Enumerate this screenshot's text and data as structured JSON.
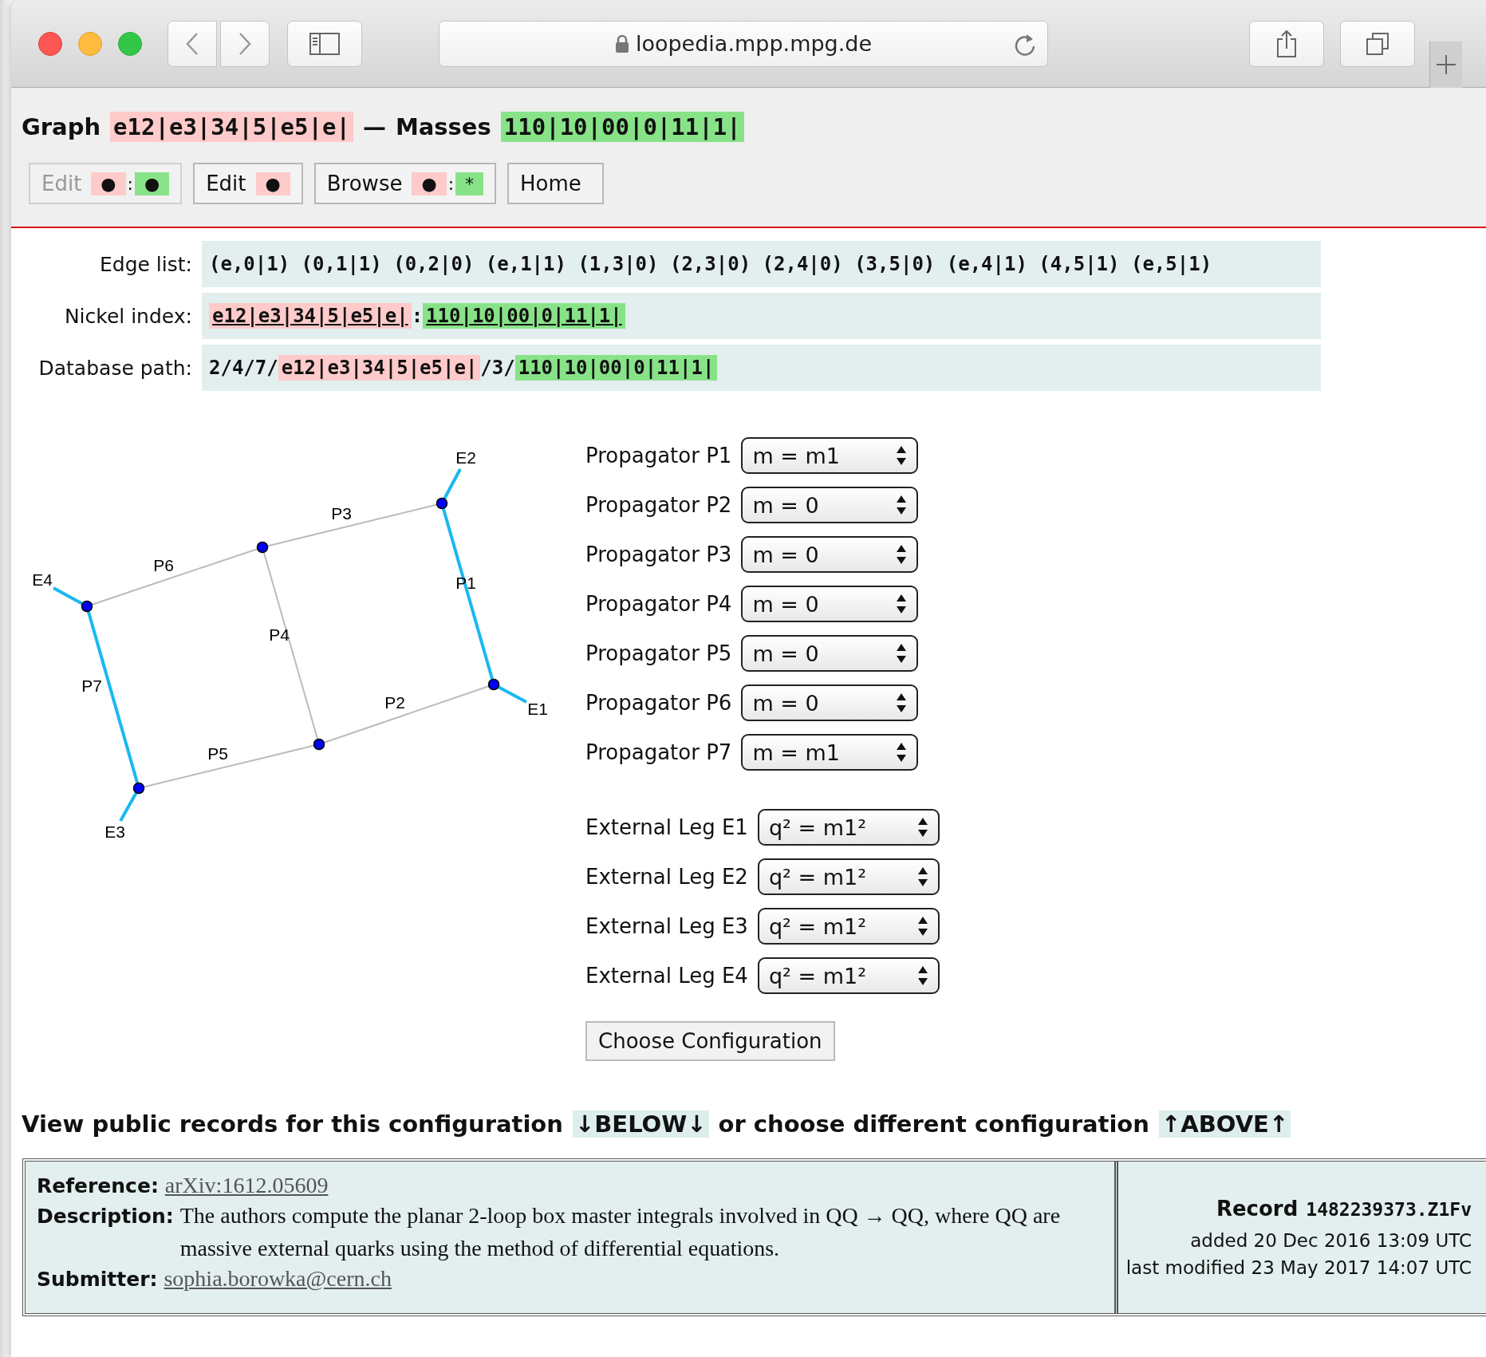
{
  "browser": {
    "url": "loopedia.mpp.mpg.de"
  },
  "header": {
    "graph_label": "Graph",
    "graph": "e12|e3|34|5|e5|e|",
    "separator": "—",
    "masses_label": "Masses",
    "masses": "110|10|00|0|11|1|"
  },
  "nav_buttons": [
    {
      "label": "Edit",
      "disabled": true,
      "parts": [
        {
          "text": "●",
          "kind": "graph"
        },
        {
          "text": ":",
          "kind": "sep"
        },
        {
          "text": "●",
          "kind": "masses"
        }
      ]
    },
    {
      "label": "Edit",
      "disabled": false,
      "parts": [
        {
          "text": "●",
          "kind": "graph"
        }
      ]
    },
    {
      "label": "Browse",
      "disabled": false,
      "parts": [
        {
          "text": "●",
          "kind": "graph"
        },
        {
          "text": ":",
          "kind": "sep"
        },
        {
          "text": "*",
          "kind": "masses"
        }
      ]
    },
    {
      "label": "Home",
      "disabled": false
    }
  ],
  "info": [
    {
      "label": "Edge list:",
      "kind": "text",
      "parts": [
        {
          "text": "(e,0|1) (0,1|1) (0,2|0) (e,1|1) (1,3|0) (2,3|0) (2,4|0) (3,5|0) (e,4|1) (4,5|1) (e,5|1)",
          "kind": "plain"
        }
      ]
    },
    {
      "label": "Nickel index:",
      "kind": "links",
      "parts": [
        {
          "text": "e12|e3|34|5|e5|e|",
          "kind": "graph"
        },
        {
          "text": ":",
          "kind": "plain"
        },
        {
          "text": "110|10|00|0|11|1|",
          "kind": "masses"
        }
      ]
    },
    {
      "label": "Database path:",
      "kind": "text",
      "parts": [
        {
          "text": "2/4/7/",
          "kind": "plain"
        },
        {
          "text": "e12|e3|34|5|e5|e|",
          "kind": "graph"
        },
        {
          "text": "/3/",
          "kind": "plain"
        },
        {
          "text": "110|10|00|0|11|1|",
          "kind": "masses"
        }
      ]
    }
  ],
  "graph": {
    "propagators": [
      {
        "label": "P1",
        "massive": true
      },
      {
        "label": "P2",
        "massive": false
      },
      {
        "label": "P3",
        "massive": false
      },
      {
        "label": "P4",
        "massive": false
      },
      {
        "label": "P5",
        "massive": false
      },
      {
        "label": "P6",
        "massive": false
      },
      {
        "label": "P7",
        "massive": true
      }
    ],
    "legs": [
      {
        "label": "E1",
        "massive": true
      },
      {
        "label": "E2",
        "massive": true
      },
      {
        "label": "E3",
        "massive": true
      },
      {
        "label": "E4",
        "massive": true
      }
    ]
  },
  "propagator_selects": [
    {
      "label": "Propagator P1",
      "value": "m = m1"
    },
    {
      "label": "Propagator P2",
      "value": "m = 0"
    },
    {
      "label": "Propagator P3",
      "value": "m = 0"
    },
    {
      "label": "Propagator P4",
      "value": "m = 0"
    },
    {
      "label": "Propagator P5",
      "value": "m = 0"
    },
    {
      "label": "Propagator P6",
      "value": "m = 0"
    },
    {
      "label": "Propagator P7",
      "value": "m = m1"
    }
  ],
  "leg_selects": [
    {
      "label": "External Leg E1",
      "value": "q² = m1²"
    },
    {
      "label": "External Leg E2",
      "value": "q² = m1²"
    },
    {
      "label": "External Leg E3",
      "value": "q² = m1²"
    },
    {
      "label": "External Leg E4",
      "value": "q² = m1²"
    }
  ],
  "submit_button": "Choose Configuration",
  "records_heading": [
    {
      "text": "View public records for this configuration",
      "kind": "text"
    },
    {
      "text": "↓BELOW↓",
      "kind": "link"
    },
    {
      "text": "or choose different configuration",
      "kind": "text"
    },
    {
      "text": "↑ABOVE↑",
      "kind": "link"
    }
  ],
  "record": {
    "reference_label": "Reference:",
    "reference": "arXiv:1612.05609",
    "description_label": "Description:",
    "description": "The authors compute the planar 2-loop box master integrals involved in QQ → QQ, where QQ are massive external quarks using the method of differential equations.",
    "submitter_label": "Submitter:",
    "submitter": "sophia.borowka@cern.ch",
    "record_label": "Record",
    "record_id": "1482239373.Z1Fv",
    "added": "added 20 Dec 2016 13:09 UTC",
    "modified": "last modified 23 May 2017 14:07 UTC"
  }
}
